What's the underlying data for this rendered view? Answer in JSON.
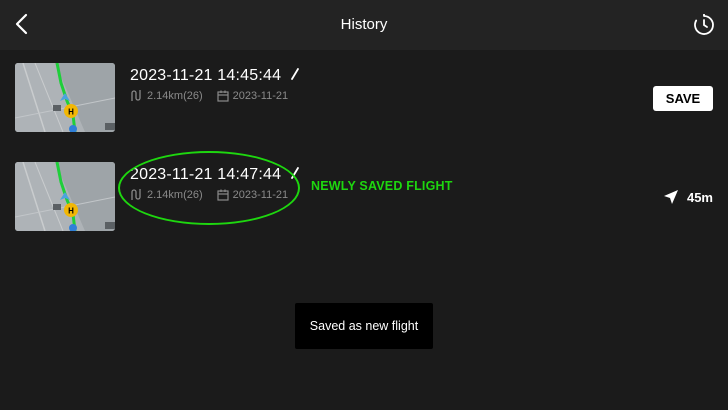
{
  "header": {
    "title": "History",
    "back_icon": "chevron-left-icon",
    "history_icon": "clock-history-icon"
  },
  "flights": [
    {
      "name": "2023-11-21 14:45:44",
      "distance": "2.14km(26)",
      "date": "2023-11-21",
      "action_label": "SAVE"
    },
    {
      "name": "2023-11-21 14:47:44",
      "distance": "2.14km(26)",
      "date": "2023-11-21"
    }
  ],
  "annotation": {
    "label": "NEWLY SAVED FLIGHT",
    "color": "#1ed70f"
  },
  "distance_indicator": {
    "value": "45m",
    "icon": "navigation-arrow-icon"
  },
  "toast": {
    "message": "Saved as new flight"
  },
  "colors": {
    "background": "#1b1b1b",
    "topbar": "#232323",
    "secondary_text": "#8a8a8a",
    "route_green": "#1fcf3a",
    "home_marker": "#f2b705",
    "drone_marker": "#4aa3df"
  }
}
